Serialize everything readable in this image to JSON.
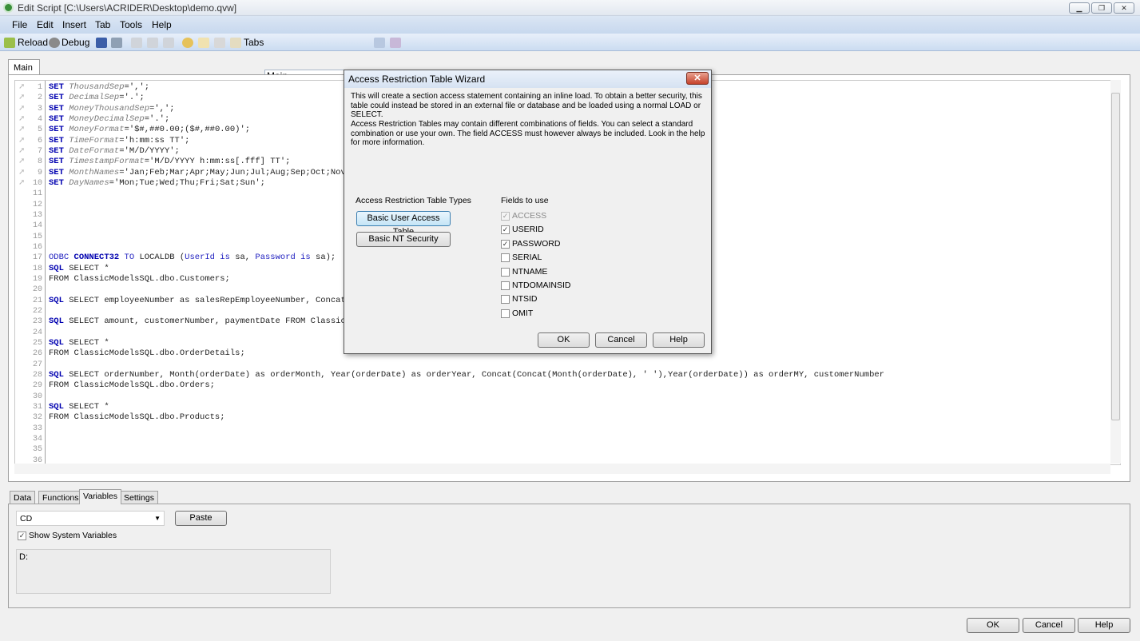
{
  "window": {
    "title": "Edit Script [C:\\Users\\ACRIDER\\Desktop\\demo.qvw]",
    "minimize": "▁",
    "restore": "❐",
    "close": "✕"
  },
  "menu": [
    "File",
    "Edit",
    "Insert",
    "Tab",
    "Tools",
    "Help"
  ],
  "toolbar": {
    "reload": "Reload",
    "debug": "Debug",
    "tabs_label": "Tabs",
    "tabs_value": "Main"
  },
  "editor": {
    "tab": "Main",
    "lines": [
      [
        [
          "kw",
          "SET "
        ],
        [
          "vr",
          "ThousandSep"
        ],
        [
          "p",
          "=',';"
        ]
      ],
      [
        [
          "kw",
          "SET "
        ],
        [
          "vr",
          "DecimalSep"
        ],
        [
          "p",
          "='.';"
        ]
      ],
      [
        [
          "kw",
          "SET "
        ],
        [
          "vr",
          "MoneyThousandSep"
        ],
        [
          "p",
          "=',';"
        ]
      ],
      [
        [
          "kw",
          "SET "
        ],
        [
          "vr",
          "MoneyDecimalSep"
        ],
        [
          "p",
          "='.';"
        ]
      ],
      [
        [
          "kw",
          "SET "
        ],
        [
          "vr",
          "MoneyFormat"
        ],
        [
          "p",
          "='$#,##0.00;($#,##0.00)';"
        ]
      ],
      [
        [
          "kw",
          "SET "
        ],
        [
          "vr",
          "TimeFormat"
        ],
        [
          "p",
          "='h:mm:ss TT';"
        ]
      ],
      [
        [
          "kw",
          "SET "
        ],
        [
          "vr",
          "DateFormat"
        ],
        [
          "p",
          "='M/D/YYYY';"
        ]
      ],
      [
        [
          "kw",
          "SET "
        ],
        [
          "vr",
          "TimestampFormat"
        ],
        [
          "p",
          "='M/D/YYYY h:mm:ss[.fff] TT';"
        ]
      ],
      [
        [
          "kw",
          "SET "
        ],
        [
          "vr",
          "MonthNames"
        ],
        [
          "p",
          "='Jan;Feb;Mar;Apr;May;Jun;Jul;Aug;Sep;Oct;Nov"
        ]
      ],
      [
        [
          "kw",
          "SET "
        ],
        [
          "vr",
          "DayNames"
        ],
        [
          "p",
          "='Mon;Tue;Wed;Thu;Fri;Sat;Sun';"
        ]
      ],
      [],
      [],
      [],
      [],
      [],
      [],
      [
        [
          "bl",
          "ODBC "
        ],
        [
          "kw",
          "CONNECT32"
        ],
        [
          "bl",
          " TO "
        ],
        [
          "p",
          "LOCALDB ("
        ],
        [
          "bl",
          "UserId is"
        ],
        [
          "p",
          " sa, "
        ],
        [
          "bl",
          "Password is"
        ],
        [
          "p",
          " sa);"
        ]
      ],
      [
        [
          "kw",
          "SQL"
        ],
        [
          "p",
          " SELECT *"
        ]
      ],
      [
        [
          "p",
          "FROM ClassicModelsSQL.dbo.Customers;"
        ]
      ],
      [],
      [
        [
          "kw",
          "SQL"
        ],
        [
          "p",
          " SELECT employeeNumber as salesRepEmployeeNumber, Concat"
        ]
      ],
      [],
      [
        [
          "kw",
          "SQL"
        ],
        [
          "p",
          " SELECT amount, customerNumber, paymentDate FROM Classic"
        ]
      ],
      [],
      [
        [
          "kw",
          "SQL"
        ],
        [
          "p",
          " SELECT *"
        ]
      ],
      [
        [
          "p",
          "FROM ClassicModelsSQL.dbo.OrderDetails;"
        ]
      ],
      [],
      [
        [
          "kw",
          "SQL"
        ],
        [
          "p",
          " SELECT orderNumber, Month(orderDate) as orderMonth, Year(orderDate) as orderYear, Concat(Concat(Month(orderDate), ' '),Year(orderDate)) as orderMY, customerNumber"
        ]
      ],
      [
        [
          "p",
          "FROM ClassicModelsSQL.dbo.Orders;"
        ]
      ],
      [],
      [
        [
          "kw",
          "SQL"
        ],
        [
          "p",
          " SELECT *"
        ]
      ],
      [
        [
          "p",
          "FROM ClassicModelsSQL.dbo.Products;"
        ]
      ],
      [],
      [],
      [],
      []
    ]
  },
  "dialog": {
    "title": "Access Restriction Table Wizard",
    "close": "✕",
    "para1": "This will create a section access statement containing an inline load. To obtain a better security, this table could instead be stored in an external file or database and be loaded using a normal LOAD or SELECT.",
    "para2": "Access Restriction Tables may contain different combinations of fields. You can select a standard combination or use your own. The field ACCESS must however always be included. Look in the help for more information.",
    "types_label": "Access Restriction Table Types",
    "basic_user": "Basic User Access Table",
    "basic_nt": "Basic NT Security",
    "fields_label": "Fields to use",
    "fields": [
      {
        "name": "ACCESS",
        "checked": true,
        "disabled": true
      },
      {
        "name": "USERID",
        "checked": true
      },
      {
        "name": "PASSWORD",
        "checked": true
      },
      {
        "name": "SERIAL",
        "checked": false
      },
      {
        "name": "NTNAME",
        "checked": false
      },
      {
        "name": "NTDOMAINSID",
        "checked": false
      },
      {
        "name": "NTSID",
        "checked": false
      },
      {
        "name": "OMIT",
        "checked": false
      }
    ],
    "ok": "OK",
    "cancel": "Cancel",
    "help": "Help"
  },
  "bottom": {
    "tabs": [
      "Data",
      "Functions",
      "Variables",
      "Settings"
    ],
    "active_tab": "Variables",
    "variable": "CD",
    "paste": "Paste",
    "show_system": "Show System Variables",
    "value": "D:"
  },
  "footer": {
    "ok": "OK",
    "cancel": "Cancel",
    "help": "Help"
  }
}
